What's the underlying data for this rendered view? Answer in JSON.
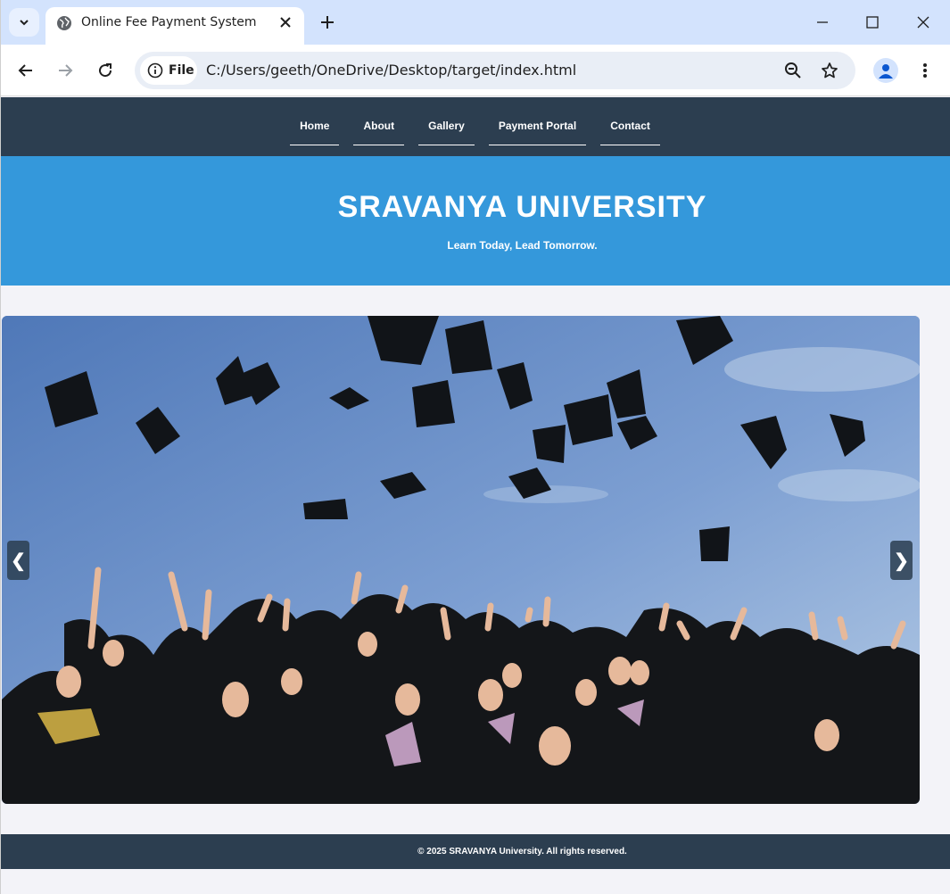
{
  "browser": {
    "tab_title": "Online Fee Payment System",
    "site_chip_label": "File",
    "url": "C:/Users/geeth/OneDrive/Desktop/target/index.html",
    "icons": [
      "tab-search-icon",
      "globe-icon",
      "close-icon",
      "plus-icon",
      "minimize-icon",
      "maximize-icon",
      "window-close-icon",
      "back-icon",
      "forward-icon",
      "reload-icon",
      "info-icon",
      "zoom-out-icon",
      "star-icon",
      "profile-icon",
      "more-vert-icon"
    ]
  },
  "nav": {
    "items": [
      {
        "label": "Home"
      },
      {
        "label": "About"
      },
      {
        "label": "Gallery"
      },
      {
        "label": "Payment Portal"
      },
      {
        "label": "Contact"
      }
    ]
  },
  "hero": {
    "title": "SRAVANYA UNIVERSITY",
    "subtitle": "Learn Today, Lead Tomorrow."
  },
  "slider": {
    "prev_label": "❮",
    "next_label": "❯",
    "image_description_name": "graduation-photo"
  },
  "footer": {
    "text": "© 2025 SRAVANYA University. All rights reserved."
  },
  "colors": {
    "nav_bg": "#2c3e50",
    "hero_bg": "#3498db",
    "page_bg": "#f3f3f8",
    "chrome_bg": "#d3e3fd"
  }
}
